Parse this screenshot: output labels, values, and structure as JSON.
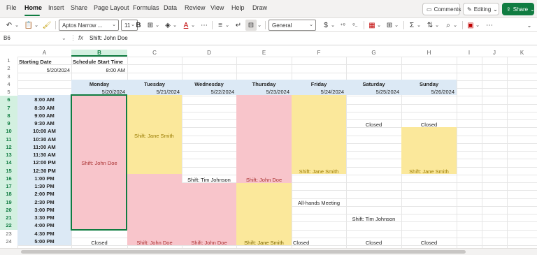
{
  "menu": {
    "tabs": [
      "File",
      "Home",
      "Insert",
      "Share",
      "Page Layout",
      "Formulas",
      "Data",
      "Review",
      "View",
      "Help",
      "Draw"
    ],
    "active": "Home",
    "comments_label": "Comments",
    "editing_label": "Editing",
    "share_label": "Share"
  },
  "ribbon": {
    "font_name": "Aptos Narrow ...",
    "font_size": "11",
    "number_format": "General",
    "currency_symbol": "$"
  },
  "formula_bar": {
    "name_box": "B6",
    "fx": "fx",
    "formula": "Shift: John Doe"
  },
  "columns": [
    "A",
    "B",
    "C",
    "D",
    "E",
    "F",
    "G",
    "H",
    "I",
    "J",
    "K"
  ],
  "selected_column": "B",
  "rows": [
    "1",
    "2",
    "3",
    "4",
    "5",
    "6",
    "7",
    "8",
    "9",
    "10",
    "11",
    "12",
    "13",
    "14",
    "15",
    "16",
    "17",
    "18",
    "19",
    "20",
    "21",
    "22",
    "23",
    "24"
  ],
  "selected_row_start": 6,
  "selected_row_end": 22,
  "colors": {
    "time_blue": "#dce9f5",
    "header_blue": "#dce9f5",
    "pink": "#f8c5cb",
    "yellow": "#fbe89b",
    "accent": "#107c41"
  },
  "sheet": {
    "a1": "Starting Date",
    "b1": "Schedule Start Time",
    "a2": "5/20/2024",
    "b2": "8:00 AM",
    "days": [
      "Monday",
      "Tuesday",
      "Wednesday",
      "Thursday",
      "Friday",
      "Saturday",
      "Sunday"
    ],
    "dates": [
      "5/20/2024",
      "5/21/2024",
      "5/22/2024",
      "5/23/2024",
      "5/24/2024",
      "5/25/2024",
      "5/26/2024"
    ],
    "times": [
      "8:00 AM",
      "8:30 AM",
      "9:00 AM",
      "9:30 AM",
      "10:00 AM",
      "10:30 AM",
      "11:00 AM",
      "11:30 AM",
      "12:00 PM",
      "12:30 PM",
      "1:00 PM",
      "1:30 PM",
      "2:00 PM",
      "2:30 PM",
      "3:00 PM",
      "3:30 PM",
      "4:00 PM",
      "4:30 PM",
      "5:00 PM"
    ],
    "mon_shift": "Shift: John Doe",
    "mon_closed": "Closed",
    "tue_shift1": "Shift: Jane Smith",
    "tue_shift2": "Shift: John Doe",
    "wed_shift1": "Shift: Tim Johnson",
    "wed_shift2": "Shift: John Doe",
    "thu_shift1": "Shift: John Doe",
    "thu_shift2": "Shift: Jane Smith",
    "fri_shift1": "Shift: Jane Smith",
    "fri_meeting": "All-hands Meeting",
    "fri_closed": "Closed",
    "sat_closed1": "Closed",
    "sat_shift": "Shift: Tim Johnson",
    "sat_closed2": "Closed",
    "sun_closed1": "Closed",
    "sun_shift": "Shift: Jane Smith",
    "sun_closed2": "Closed"
  }
}
